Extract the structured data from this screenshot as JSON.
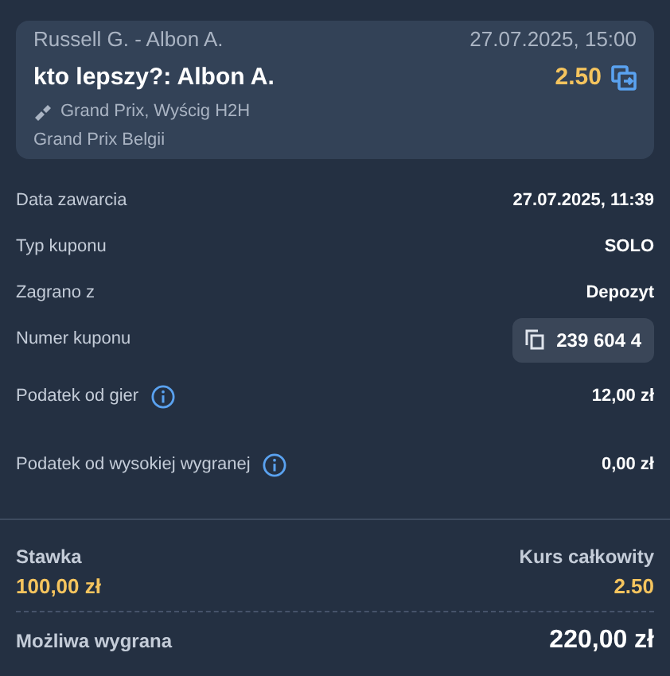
{
  "event": {
    "teams": "Russell G. - Albon A.",
    "datetime": "27.07.2025, 15:00",
    "selection": "kto lepszy?: Albon A.",
    "odds": "2.50",
    "market": "Grand Prix, Wyścig H2H",
    "competition": "Grand Prix Belgii"
  },
  "details": [
    {
      "kind": "plain",
      "label": "Data zawarcia",
      "value": "27.07.2025, 11:39"
    },
    {
      "kind": "plain",
      "label": "Typ kuponu",
      "value": "SOLO"
    },
    {
      "kind": "plain",
      "label": "Zagrano z",
      "value": "Depozyt"
    },
    {
      "kind": "copy",
      "label": "Numer kuponu",
      "value": "239 604 4"
    },
    {
      "kind": "info",
      "label": "Podatek od gier",
      "value": "12,00 zł"
    },
    {
      "kind": "info",
      "label": "Podatek od wysokiej wygranej",
      "value": "0,00 zł"
    }
  ],
  "summary": {
    "stake_label": "Stawka",
    "stake": "100,00 zł",
    "odds_label": "Kurs całkowity",
    "odds": "2.50",
    "win_label": "Możliwa wygrana",
    "win": "220,00 zł"
  }
}
